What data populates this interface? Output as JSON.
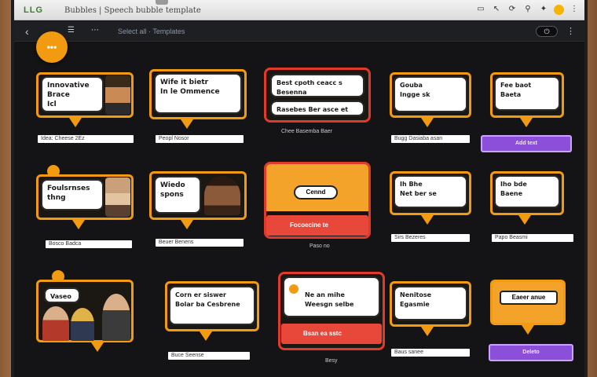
{
  "browser": {
    "logo_letters": "LLG",
    "page_title": "Bubbles  |  Speech bubble template",
    "tab_icons": [
      "window-icon",
      "cursor-icon",
      "refresh-icon",
      "lock-icon",
      "star-icon",
      "profile-icon",
      "more-icon"
    ],
    "toolbar": {
      "back": "‹",
      "btn_a": "☰",
      "btn_b": "⋯",
      "address": "Select all  ·  Templates",
      "toggle": "⏻",
      "menu": "⋮"
    }
  },
  "fab": {
    "label": "•••"
  },
  "cards": {
    "c1": {
      "bubble": "Innovative\nBrace\nIcl",
      "caption": "Idea: Cheese 2Ez"
    },
    "c2": {
      "bubble": "Wife it bietr\nIn le Ommence",
      "caption": "Peopl Nosor"
    },
    "c3": {
      "bubble": "Best cpoth ceacc s\nBesenna",
      "bubble2": "Rasebes Ber asce et",
      "caption": "Chee Basemba Baer"
    },
    "c4": {
      "bubble": "Gouba\nIngge sk",
      "caption": "Bugg Dasiaba asan"
    },
    "c5": {
      "bubble": "Fee baot\nBaeta",
      "button": "Add text"
    },
    "r2c1": {
      "bubble": "Foulsrnses\nthng",
      "caption": "Bosco Badca"
    },
    "r2c2": {
      "bubble": "Wiedo\nspons",
      "caption": "Beuer Benens"
    },
    "r2c3": {
      "pill": "Cennd",
      "bar": "Focoecine te",
      "under": "Paso no"
    },
    "r2c4": {
      "bubble": "Ih Bhe\nNet ber se",
      "caption": "Sirs Bezeres"
    },
    "r2c5": {
      "bubble": "Iho bde\nBaene",
      "caption": "Papo Beasmi"
    },
    "r3c1": {
      "bubble": "Vaseo",
      "caption": ""
    },
    "r3c2": {
      "bubble": "Corn er siswer\nBolar ba Cesbrene",
      "caption": "Buce Seense"
    },
    "r3c3": {
      "bubble": "Ne an mihe\nWeesgn selbe",
      "bar": "Bsan ea sstc",
      "under": "Besy"
    },
    "r3c4": {
      "bubble": "Nenitose\nEgasmie",
      "caption": "Baus sanee"
    },
    "r3c5": {
      "pill": "Eaeer anue",
      "button": "Deleto"
    }
  },
  "colors": {
    "accent": "#f29a10",
    "purple": "#8b4fd9",
    "red": "#e23a2a"
  }
}
